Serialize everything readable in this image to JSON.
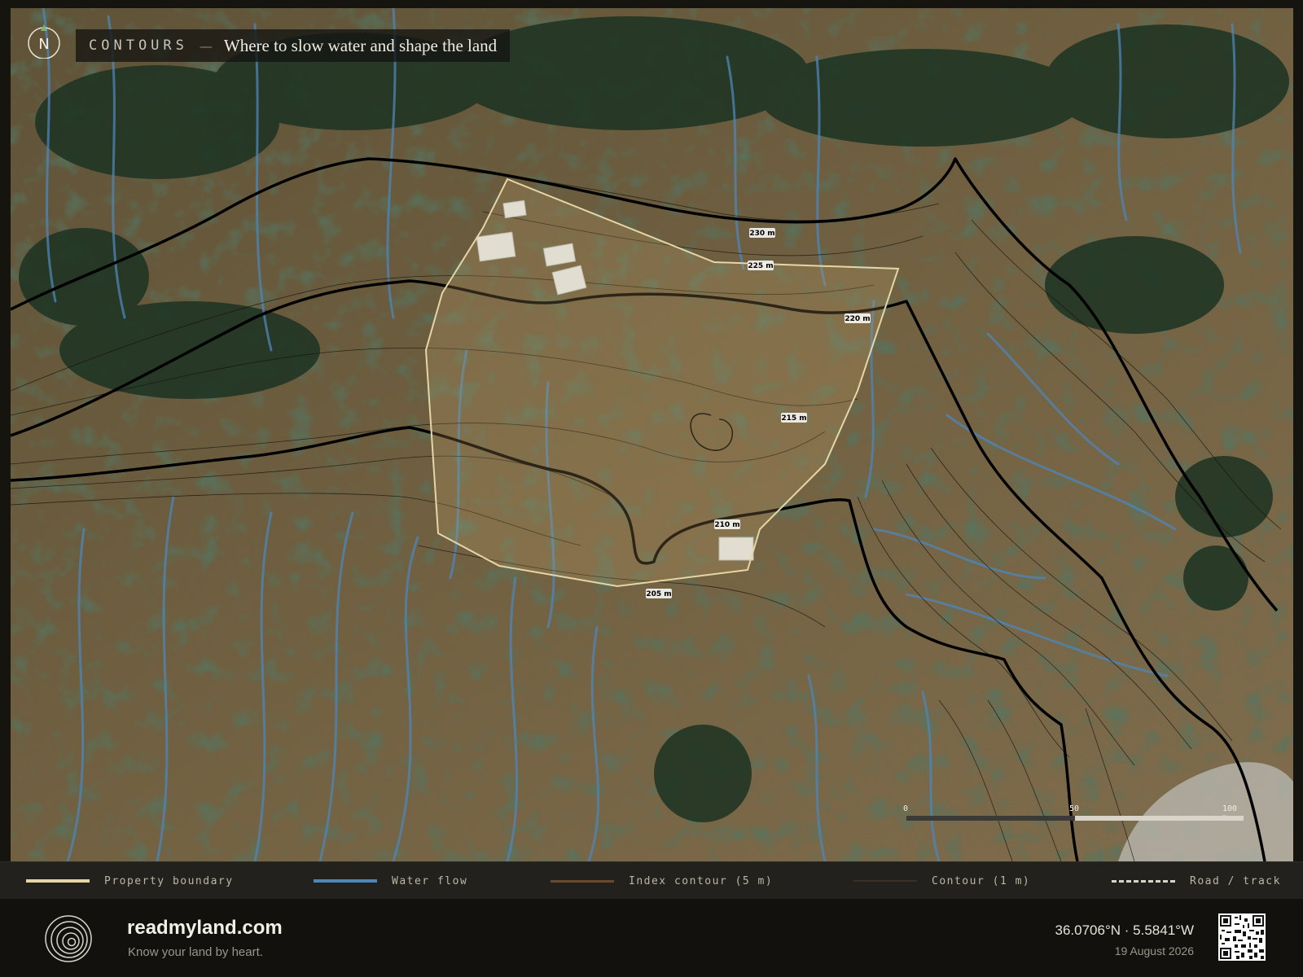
{
  "title": {
    "kicker": "CONTOURS",
    "separator": "—",
    "text": "Where to slow water and shape the land"
  },
  "north_arrow": {
    "label": "N"
  },
  "contour_labels": [
    "230 m",
    "225 m",
    "220 m",
    "215 m",
    "210 m",
    "205 m"
  ],
  "scale_bar": {
    "labels": [
      "0",
      "50",
      "100 m"
    ]
  },
  "legend": [
    {
      "label": "Property boundary",
      "color": "#e6d6a6",
      "style": "solid"
    },
    {
      "label": "Water flow",
      "color": "#4e86b8",
      "style": "solid"
    },
    {
      "label": "Index contour (5 m)",
      "color": "#6a4a2c",
      "style": "solid"
    },
    {
      "label": "Contour (1 m)",
      "color": "#3b3024",
      "style": "solid"
    },
    {
      "label": "Road / track",
      "color": "#d9d4c8",
      "style": "dashed"
    }
  ],
  "footer": {
    "brand": "readmyland.com",
    "tagline": "Know your land by heart.",
    "coordinates": "36.0706°N · 5.5841°W",
    "date": "19 August 2026"
  },
  "colors": {
    "terrain": "#6e5b3a",
    "vegetation": "#1f3a24",
    "water": "#4e86b8",
    "contour": "#000000",
    "boundary": "#e6d6a6"
  }
}
